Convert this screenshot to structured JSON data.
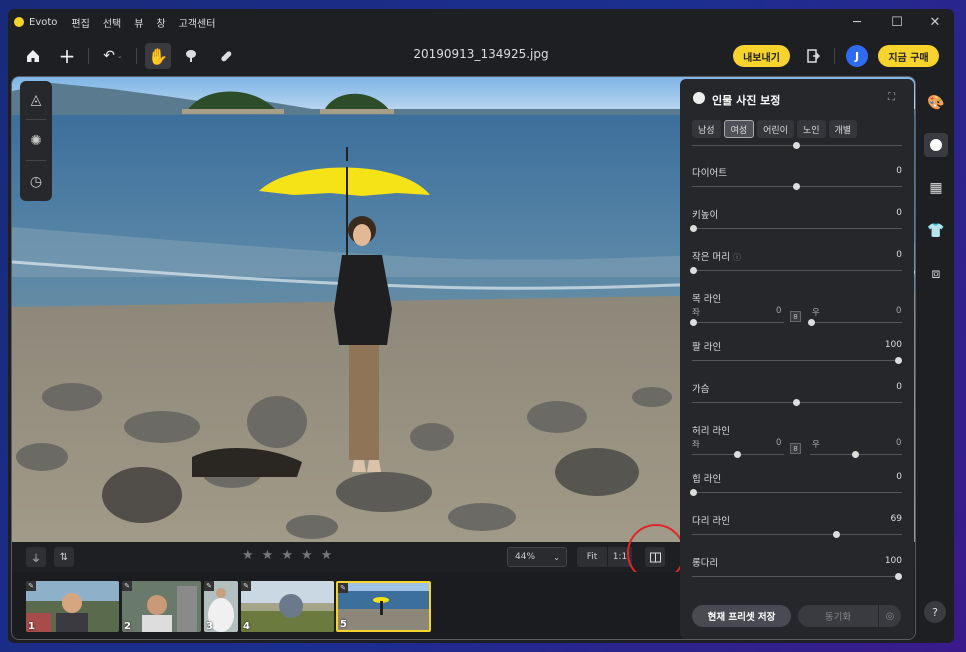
{
  "app": {
    "name": "Evoto"
  },
  "menu": [
    "편집",
    "선택",
    "뷰",
    "창",
    "고객센터"
  ],
  "toolbar": {
    "filename": "20190913_134925.jpg",
    "export_label": "내보내기",
    "avatar_initial": "J",
    "buy_label": "지금 구매"
  },
  "bottom_bar": {
    "zoom": "44%",
    "fit_label": "Fit",
    "one_to_one_label": "1:1",
    "rating_stars": 5
  },
  "filmstrip": [
    {
      "num": "1",
      "selected": false
    },
    {
      "num": "2",
      "selected": false
    },
    {
      "num": "3",
      "selected": false
    },
    {
      "num": "4",
      "selected": false
    },
    {
      "num": "5",
      "selected": true
    }
  ],
  "panel": {
    "title": "인물 사진 보정",
    "presets": [
      "남성",
      "여성",
      "어린이",
      "노인",
      "개별"
    ],
    "active_preset": "여성",
    "sliders": [
      {
        "label": "다이어트",
        "value": "0",
        "position": 0.5
      },
      {
        "label": "키높이",
        "value": "0",
        "position": 0.0
      },
      {
        "label": "작은 머리",
        "value": "0",
        "position": 0.0
      },
      {
        "label": "목 라인",
        "left_label": "좌",
        "left_value": "0",
        "right_label": "우",
        "right_value": "0",
        "left_position": 0.0,
        "right_position": 0.0
      },
      {
        "label": "팔 라인",
        "value": "100",
        "position": 1.0
      },
      {
        "label": "가슴",
        "value": "0",
        "position": 0.5
      },
      {
        "label": "허리 라인",
        "left_label": "좌",
        "left_value": "0",
        "right_label": "우",
        "right_value": "0",
        "left_position": 0.5,
        "right_position": 0.5
      },
      {
        "label": "힙 라인",
        "value": "0",
        "position": 0.0
      },
      {
        "label": "다리 라인",
        "value": "69",
        "position": 0.69
      },
      {
        "label": "롱다리",
        "value": "100",
        "position": 1.0
      }
    ],
    "save_preset_label": "현재 프리셋 저장",
    "sync_label": "동기화"
  },
  "help_label": "?",
  "colors": {
    "accent": "#f7d32d",
    "panel_bg": "#26272b",
    "window_bg": "#1e1f22",
    "highlight_circle": "#e0262b"
  }
}
